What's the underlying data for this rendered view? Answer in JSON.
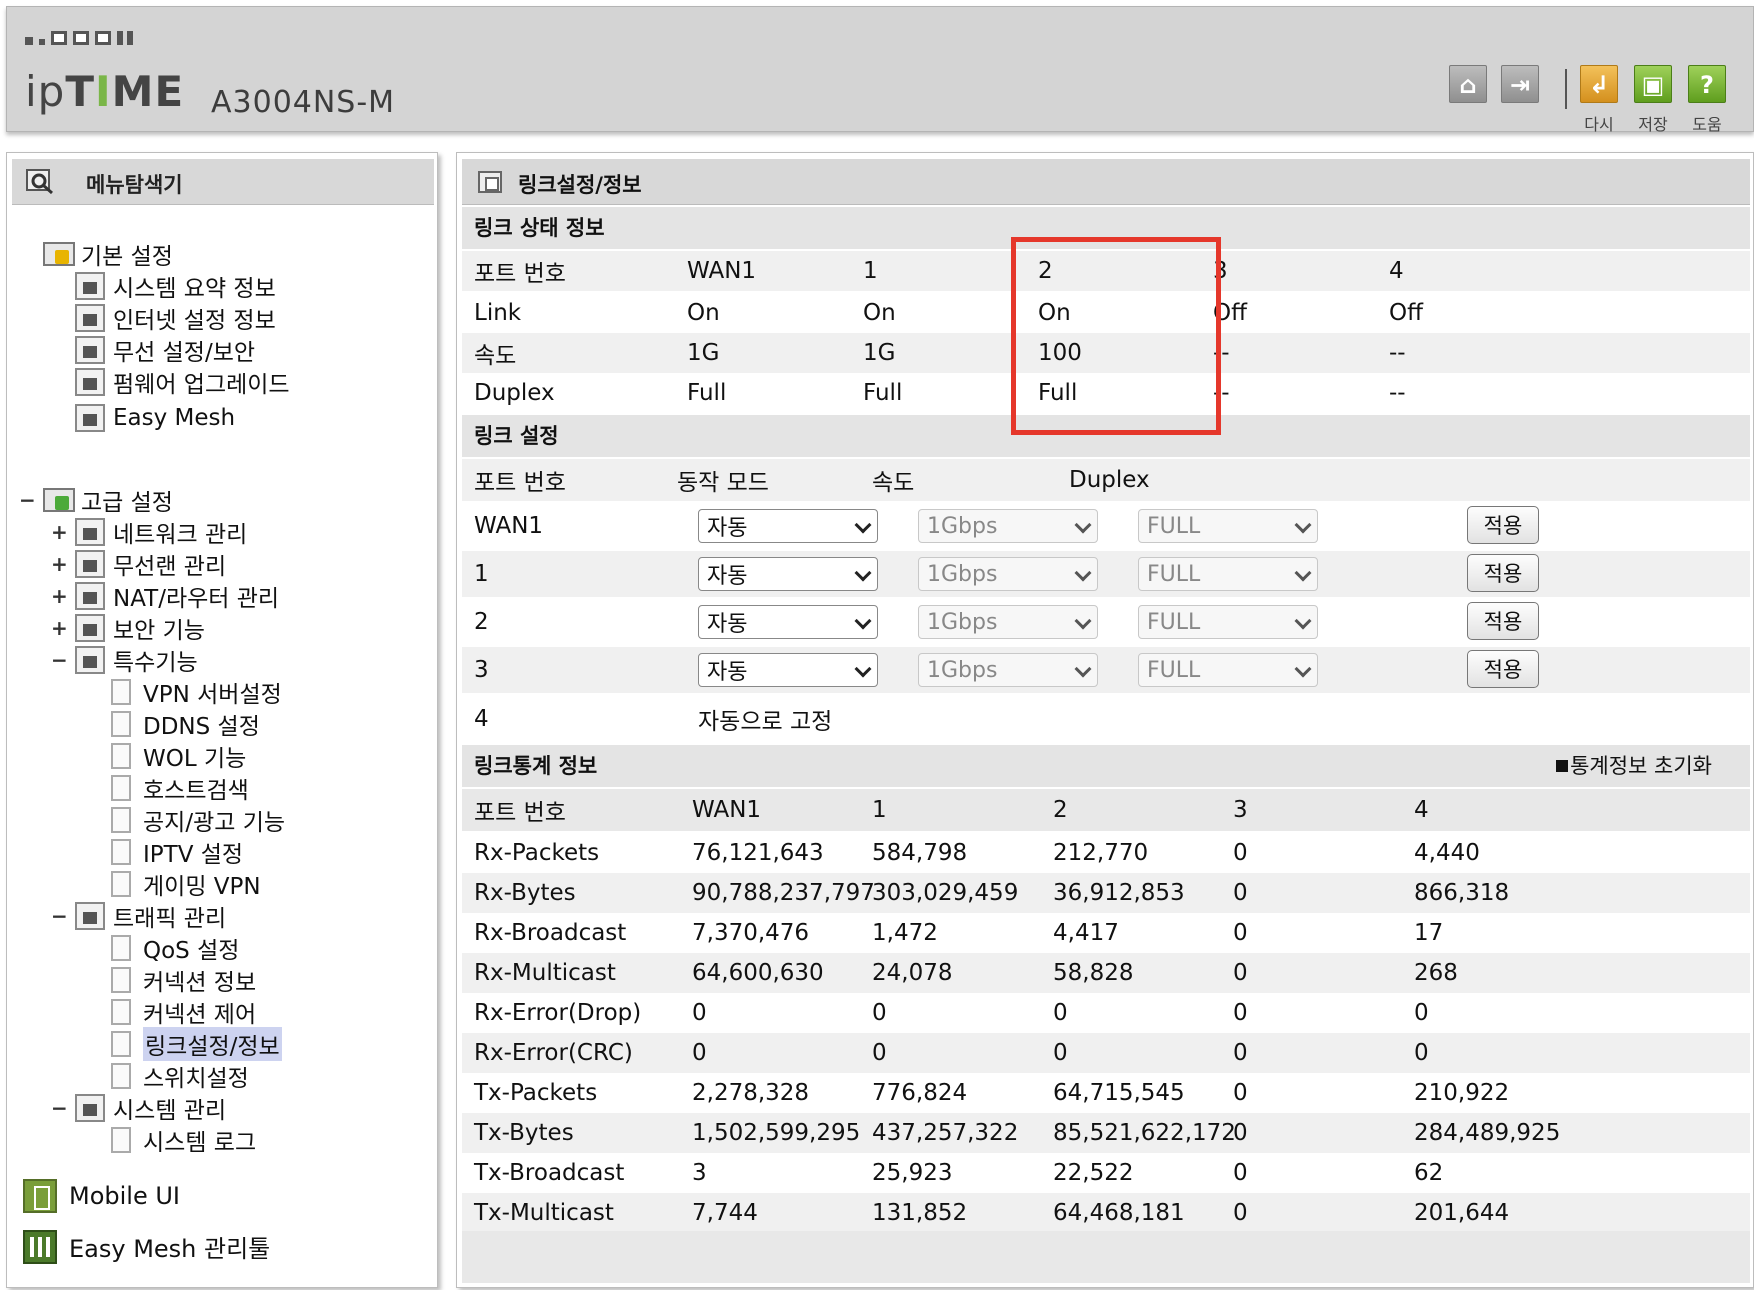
{
  "header": {
    "brand": "ipTIME",
    "model": "A3004NS-M",
    "buttons": [
      {
        "name": "home",
        "label": ""
      },
      {
        "name": "logout",
        "label": ""
      },
      {
        "name": "reload",
        "label": "다시"
      },
      {
        "name": "save",
        "label": "저장"
      },
      {
        "name": "help",
        "label": "도움"
      }
    ]
  },
  "sidebar": {
    "title": "메뉴탐색기",
    "basic": {
      "label": "기본 설정",
      "items": [
        "시스템 요약 정보",
        "인터넷 설정 정보",
        "무선 설정/보안",
        "펌웨어 업그레이드",
        "Easy Mesh"
      ]
    },
    "advanced": {
      "label": "고급 설정",
      "groups": [
        {
          "label": "네트워크 관리",
          "toggle": "+"
        },
        {
          "label": "무선랜 관리",
          "toggle": "+"
        },
        {
          "label": "NAT/라우터 관리",
          "toggle": "+"
        },
        {
          "label": "보안 기능",
          "toggle": "+"
        },
        {
          "label": "특수기능",
          "toggle": "−"
        }
      ],
      "special_items": [
        "VPN 서버설정",
        "DDNS 설정",
        "WOL 기능",
        "호스트검색",
        "공지/광고 기능",
        "IPTV 설정",
        "게이밍 VPN"
      ],
      "traffic": {
        "label": "트래픽 관리",
        "toggle": "−"
      },
      "traffic_items": [
        "QoS 설정",
        "커넥션 정보",
        "커넥션 제어",
        "링크설정/정보",
        "스위치설정"
      ],
      "system": {
        "label": "시스템 관리",
        "toggle": "−"
      },
      "system_items": [
        "시스템 로그"
      ]
    },
    "bottom": [
      "Mobile UI",
      "Easy Mesh 관리툴"
    ]
  },
  "main": {
    "title": "링크설정/정보",
    "status": {
      "title": "링크 상태 정보",
      "header": [
        "포트 번호",
        "WAN1",
        "1",
        "2",
        "3",
        "4"
      ],
      "rows": [
        [
          "Link",
          "On",
          "On",
          "On",
          "Off",
          "Off"
        ],
        [
          "속도",
          "1G",
          "1G",
          "100",
          "--",
          "--"
        ],
        [
          "Duplex",
          "Full",
          "Full",
          "Full",
          "--",
          "--"
        ]
      ]
    },
    "config": {
      "title": "링크 설정",
      "header": [
        "포트 번호",
        "동작 모드",
        "속도",
        "Duplex"
      ],
      "rows": [
        {
          "port": "WAN1",
          "mode": "자동",
          "speed": "1Gbps",
          "duplex": "FULL",
          "apply": "적용"
        },
        {
          "port": "1",
          "mode": "자동",
          "speed": "1Gbps",
          "duplex": "FULL",
          "apply": "적용"
        },
        {
          "port": "2",
          "mode": "자동",
          "speed": "1Gbps",
          "duplex": "FULL",
          "apply": "적용"
        },
        {
          "port": "3",
          "mode": "자동",
          "speed": "1Gbps",
          "duplex": "FULL",
          "apply": "적용"
        }
      ],
      "fixed_row": {
        "port": "4",
        "text": "자동으로 고정"
      }
    },
    "stats": {
      "title": "링크통계 정보",
      "reset": "통계정보 초기화",
      "header": [
        "포트 번호",
        "WAN1",
        "1",
        "2",
        "3",
        "4"
      ],
      "rows": [
        [
          "Rx-Packets",
          "76,121,643",
          "584,798",
          "212,770",
          "0",
          "4,440"
        ],
        [
          "Rx-Bytes",
          "90,788,237,797",
          "303,029,459",
          "36,912,853",
          "0",
          "866,318"
        ],
        [
          "Rx-Broadcast",
          "7,370,476",
          "1,472",
          "4,417",
          "0",
          "17"
        ],
        [
          "Rx-Multicast",
          "64,600,630",
          "24,078",
          "58,828",
          "0",
          "268"
        ],
        [
          "Rx-Error(Drop)",
          "0",
          "0",
          "0",
          "0",
          "0"
        ],
        [
          "Rx-Error(CRC)",
          "0",
          "0",
          "0",
          "0",
          "0"
        ],
        [
          "Tx-Packets",
          "2,278,328",
          "776,824",
          "64,715,545",
          "0",
          "210,922"
        ],
        [
          "Tx-Bytes",
          "1,502,599,295",
          "437,257,322",
          "85,521,622,172",
          "0",
          "284,489,925"
        ],
        [
          "Tx-Broadcast",
          "3",
          "25,923",
          "22,522",
          "0",
          "62"
        ],
        [
          "Tx-Multicast",
          "7,744",
          "131,852",
          "64,468,181",
          "0",
          "201,644"
        ]
      ]
    }
  }
}
